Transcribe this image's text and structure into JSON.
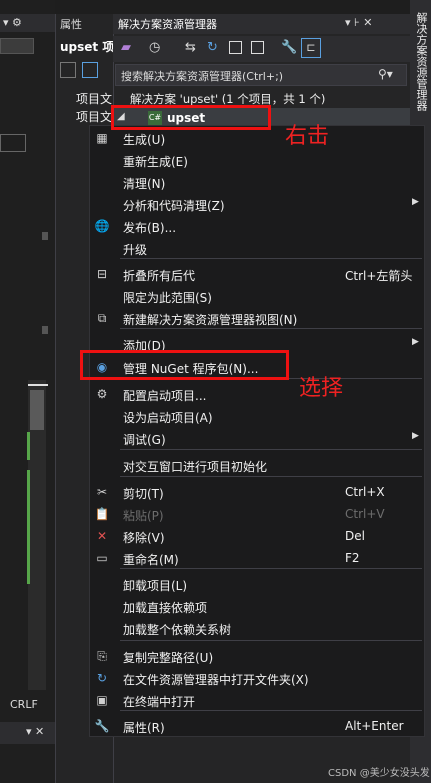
{
  "left_panel": {
    "top_icons": "▾ ⚙",
    "status_crlf": "CRLF",
    "bottom_controls": "▾ ✕"
  },
  "properties": {
    "tab_label": "属性",
    "object_name": "upset 项",
    "rows": [
      "项目文",
      "项目文"
    ]
  },
  "solution_explorer": {
    "title": "解决方案资源管理器",
    "title_controls": "▾ ⊦ ✕",
    "search_placeholder": "搜索解决方案资源管理器(Ctrl+;)",
    "solution_row": "解决方案 'upset' (1 个项目，共 1 个)",
    "project_name": "upset",
    "side_tab_label": "解决方案资源管理器"
  },
  "context_menu": {
    "items": [
      {
        "icon": "build-icon",
        "glyph": "▦",
        "label": "生成(U)",
        "shortcut": "",
        "submenu": false,
        "disabled": false
      },
      {
        "icon": "",
        "glyph": "",
        "label": "重新生成(E)",
        "shortcut": "",
        "submenu": false,
        "disabled": false
      },
      {
        "icon": "",
        "glyph": "",
        "label": "清理(N)",
        "shortcut": "",
        "submenu": false,
        "disabled": false
      },
      {
        "icon": "",
        "glyph": "",
        "label": "分析和代码清理(Z)",
        "shortcut": "",
        "submenu": true,
        "disabled": false
      },
      {
        "icon": "globe-icon",
        "glyph": "🌐",
        "label": "发布(B)...",
        "shortcut": "",
        "submenu": false,
        "disabled": false
      },
      {
        "icon": "",
        "glyph": "",
        "label": "升级",
        "shortcut": "",
        "submenu": false,
        "disabled": false
      },
      {
        "icon": "collapse-icon",
        "glyph": "⊟",
        "label": "折叠所有后代",
        "shortcut": "Ctrl+左箭头",
        "submenu": false,
        "disabled": false
      },
      {
        "icon": "",
        "glyph": "",
        "label": "限定为此范围(S)",
        "shortcut": "",
        "submenu": false,
        "disabled": false
      },
      {
        "icon": "new-view-icon",
        "glyph": "⧉",
        "label": "新建解决方案资源管理器视图(N)",
        "shortcut": "",
        "submenu": false,
        "disabled": false
      },
      {
        "icon": "",
        "glyph": "",
        "label": "添加(D)",
        "shortcut": "",
        "submenu": true,
        "disabled": false
      },
      {
        "icon": "nuget-icon",
        "glyph": "◉",
        "label": "管理 NuGet 程序包(N)...",
        "shortcut": "",
        "submenu": false,
        "disabled": false
      },
      {
        "icon": "gear-icon",
        "glyph": "⚙",
        "label": "配置启动项目...",
        "shortcut": "",
        "submenu": false,
        "disabled": false
      },
      {
        "icon": "",
        "glyph": "",
        "label": "设为启动项目(A)",
        "shortcut": "",
        "submenu": false,
        "disabled": false
      },
      {
        "icon": "",
        "glyph": "",
        "label": "调试(G)",
        "shortcut": "",
        "submenu": true,
        "disabled": false
      },
      {
        "icon": "",
        "glyph": "",
        "label": "对交互窗口进行项目初始化",
        "shortcut": "",
        "submenu": false,
        "disabled": false
      },
      {
        "icon": "scissors-icon",
        "glyph": "✂",
        "label": "剪切(T)",
        "shortcut": "Ctrl+X",
        "submenu": false,
        "disabled": false
      },
      {
        "icon": "paste-icon",
        "glyph": "📋",
        "label": "粘贴(P)",
        "shortcut": "Ctrl+V",
        "submenu": false,
        "disabled": true
      },
      {
        "icon": "remove-icon",
        "glyph": "✕",
        "label": "移除(V)",
        "shortcut": "Del",
        "submenu": false,
        "disabled": false
      },
      {
        "icon": "rename-icon",
        "glyph": "▭",
        "label": "重命名(M)",
        "shortcut": "F2",
        "submenu": false,
        "disabled": false
      },
      {
        "icon": "",
        "glyph": "",
        "label": "卸载项目(L)",
        "shortcut": "",
        "submenu": false,
        "disabled": false
      },
      {
        "icon": "",
        "glyph": "",
        "label": "加载直接依赖项",
        "shortcut": "",
        "submenu": false,
        "disabled": false
      },
      {
        "icon": "",
        "glyph": "",
        "label": "加载整个依赖关系树",
        "shortcut": "",
        "submenu": false,
        "disabled": false
      },
      {
        "icon": "copy-icon",
        "glyph": "⎘",
        "label": "复制完整路径(U)",
        "shortcut": "",
        "submenu": false,
        "disabled": false
      },
      {
        "icon": "open-folder-icon",
        "glyph": "↻",
        "label": "在文件资源管理器中打开文件夹(X)",
        "shortcut": "",
        "submenu": false,
        "disabled": false
      },
      {
        "icon": "terminal-icon",
        "glyph": "▣",
        "label": "在终端中打开",
        "shortcut": "",
        "submenu": false,
        "disabled": false
      },
      {
        "icon": "wrench-icon",
        "glyph": "🔧",
        "label": "属性(R)",
        "shortcut": "Alt+Enter",
        "submenu": false,
        "disabled": false
      }
    ]
  },
  "annotations": {
    "right_click": "右击",
    "select": "选择"
  },
  "watermark": "CSDN @美少女没头发",
  "colors": {
    "remove_icon": "#e05252",
    "annotation": "#ee1111",
    "nuget_icon": "#5aa0e0"
  }
}
